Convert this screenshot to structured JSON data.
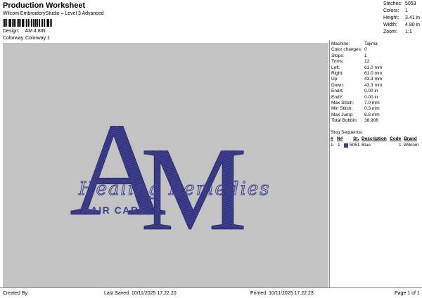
{
  "header": {
    "title": "Production Worksheet",
    "subtitle": "Wilcom EmbroideryStudio – Level 3 Advanced",
    "design_label": "Design:",
    "design_value": "AM 4.8IN",
    "colorway_label": "Colorway:",
    "colorway_value": "Colorway 1"
  },
  "stats": [
    {
      "label": "Stitches:",
      "value": "5053"
    },
    {
      "label": "Colors:",
      "value": "1"
    },
    {
      "label": "Height:",
      "value": "3.41 in"
    },
    {
      "label": "Width:",
      "value": "4.80 in"
    },
    {
      "label": "Zoom:",
      "value": "1:1"
    }
  ],
  "machine": [
    {
      "label": "Machine:",
      "value": "Tajima"
    },
    {
      "label": "Color changes:",
      "value": "0"
    },
    {
      "label": "Stops:",
      "value": "1"
    },
    {
      "label": "Trims:",
      "value": "12"
    },
    {
      "label": "Left:",
      "value": "61.0 mm"
    },
    {
      "label": "Right:",
      "value": "61.0 mm"
    },
    {
      "label": "Up:",
      "value": "43.3 mm"
    },
    {
      "label": "Down:",
      "value": "43.3 mm"
    },
    {
      "label": "EndX:",
      "value": "0.00 in"
    },
    {
      "label": "EndY:",
      "value": "0.00 in"
    },
    {
      "label": "Max Stitch:",
      "value": "7.0 mm"
    },
    {
      "label": "Min Stitch:",
      "value": "0.3 mm"
    },
    {
      "label": "Max Jump:",
      "value": "6.8 mm"
    },
    {
      "label": "Total Bobbin:",
      "value": "38.90ft"
    }
  ],
  "stop_sequence": {
    "title": "Stop Sequence:",
    "headers": {
      "num": "#",
      "n": "N#",
      "st": "St.",
      "desc": "Description",
      "code": "Code",
      "brand": "Brand"
    },
    "rows": [
      {
        "num": "1.",
        "n": "1",
        "st": "5051",
        "desc": "Blue",
        "code": "1",
        "brand": "Wilcom",
        "color": "#3c3c8c"
      }
    ]
  },
  "design_text": {
    "letter_a": "A",
    "letter_m": "M",
    "script": "Healing Remedies",
    "caption": "HAIR CARE",
    "thread_color": "#3c3c8c"
  },
  "footer": {
    "created_by": "Created By:",
    "last_saved": "Last Saved: 10/11/2025 17.22.20",
    "printed": "Printed: 10/11/2025 17.22.23",
    "page": "Page 1 of 1"
  }
}
